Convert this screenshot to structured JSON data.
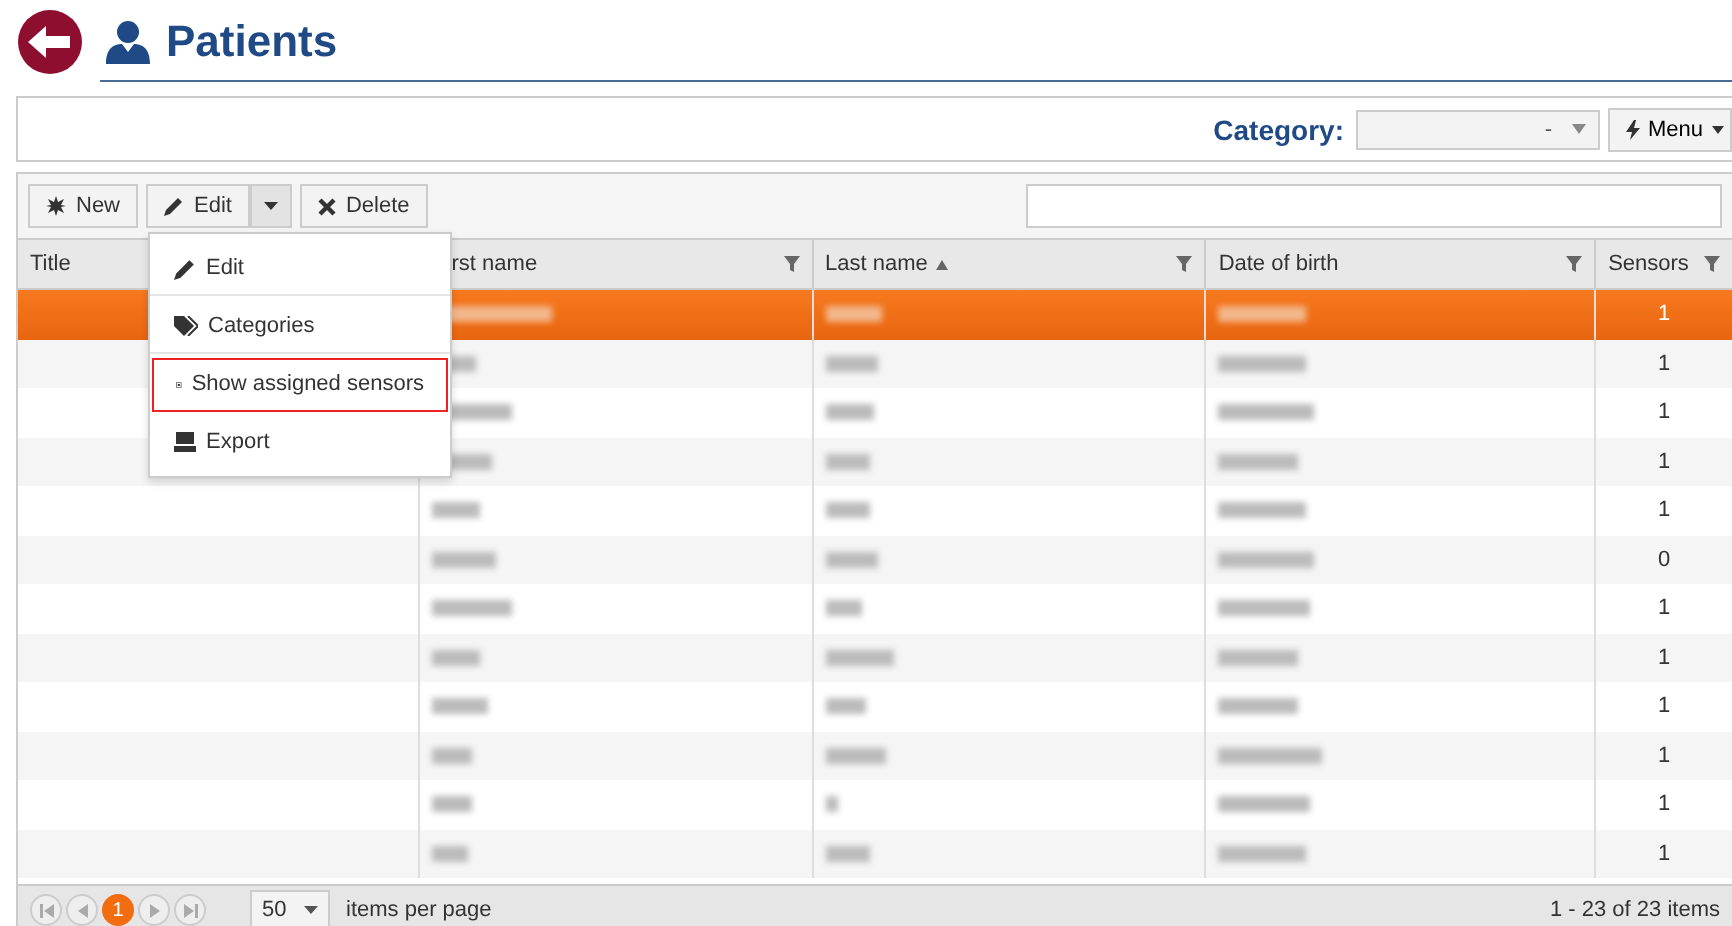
{
  "page": {
    "title": "Patients"
  },
  "filter_bar": {
    "category_label": "Category:",
    "category_value": "-",
    "menu_button": "Menu"
  },
  "toolbar": {
    "buttons": [
      {
        "kind": "new",
        "label": "New"
      },
      {
        "kind": "edit",
        "label": "Edit"
      },
      {
        "kind": "delete",
        "label": "Delete"
      }
    ]
  },
  "edit_menu": {
    "items": [
      {
        "kind": "edit",
        "label": "Edit",
        "selected": false
      },
      {
        "kind": "tag",
        "label": "Categories",
        "selected": false
      },
      {
        "kind": "chip",
        "label": "Show assigned sensors",
        "selected": true
      },
      {
        "kind": "export",
        "label": "Export",
        "selected": false
      }
    ]
  },
  "table": {
    "columns": [
      {
        "label": "Title",
        "sorted": false,
        "filter": false
      },
      {
        "label": "rst name",
        "sorted": false,
        "filter": true
      },
      {
        "label": "Last name",
        "sorted": true,
        "filter": true
      },
      {
        "label": "Date of birth",
        "sorted": false,
        "filter": true
      },
      {
        "label": "Sensors",
        "sorted": false,
        "filter": true
      }
    ],
    "rows": [
      {
        "sensors": "1",
        "selected": true
      },
      {
        "sensors": "1",
        "selected": false
      },
      {
        "sensors": "1",
        "selected": false
      },
      {
        "sensors": "1",
        "selected": false
      },
      {
        "sensors": "1",
        "selected": false
      },
      {
        "sensors": "0",
        "selected": false
      },
      {
        "sensors": "1",
        "selected": false
      },
      {
        "sensors": "1",
        "selected": false
      },
      {
        "sensors": "1",
        "selected": false
      },
      {
        "sensors": "1",
        "selected": false
      },
      {
        "sensors": "1",
        "selected": false
      },
      {
        "sensors": "1",
        "selected": false
      }
    ]
  },
  "pager": {
    "pages": [
      {
        "label": "1",
        "selected": true
      }
    ],
    "page_size": "50",
    "page_size_label": "items per page",
    "summary": "1 - 23 of 23 items"
  }
}
